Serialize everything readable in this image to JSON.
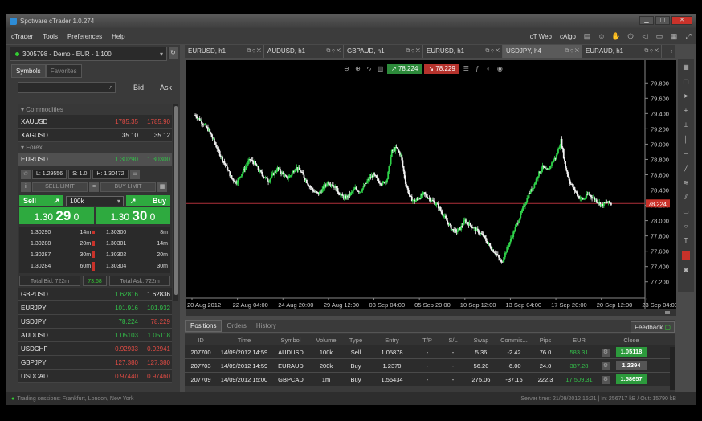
{
  "window": {
    "title": "Spotware cTrader 1.0.274"
  },
  "menu": {
    "items": [
      "cTrader",
      "Tools",
      "Preferences",
      "Help"
    ],
    "ctweb": "cT Web",
    "calgo": "cAlgo"
  },
  "account": {
    "label": "3005798 - Demo - EUR - 1:100"
  },
  "left_tabs": [
    "Symbols",
    "Favorites"
  ],
  "market_header": {
    "bid": "Bid",
    "ask": "Ask"
  },
  "groups": {
    "commodities": "Commodities",
    "forex": "Forex"
  },
  "commodities": [
    {
      "name": "XAUUSD",
      "bid": "1785.35",
      "ask": "1785.90"
    },
    {
      "name": "XAGUSD",
      "bid": "35.10",
      "ask": "35.12"
    }
  ],
  "eurusd": {
    "name": "EURUSD",
    "bid": "1.30290",
    "ask": "1.30300",
    "low": "L: 1.29556",
    "spread": "S: 1.0",
    "high": "H: 1.30472",
    "sell_limit": "SELL LIMIT",
    "buy_limit": "BUY LIMIT",
    "sell": "Sell",
    "buy": "Buy",
    "volume": "100k",
    "sell_big_a": "1.30",
    "sell_big_b": "29",
    "sell_big_c": "0",
    "buy_big_a": "1.30",
    "buy_big_b": "30",
    "buy_big_c": "0",
    "depth_bid": [
      {
        "p": "1.30290",
        "v": "14m"
      },
      {
        "p": "1.30288",
        "v": "20m"
      },
      {
        "p": "1.30287",
        "v": "30m"
      },
      {
        "p": "1.30284",
        "v": "60m"
      }
    ],
    "depth_ask": [
      {
        "p": "1.30300",
        "v": "8m"
      },
      {
        "p": "1.30301",
        "v": "14m"
      },
      {
        "p": "1.30302",
        "v": "20m"
      },
      {
        "p": "1.30304",
        "v": "30m"
      }
    ],
    "total_bid": "Total Bid: 722m",
    "spread_total": "73.68",
    "total_ask": "Total Ask: 722m"
  },
  "forex": [
    {
      "name": "GBPUSD",
      "bid": "1.62816",
      "ask": "1.62836",
      "bc": "grn",
      "ac": "wht"
    },
    {
      "name": "EURJPY",
      "bid": "101.916",
      "ask": "101.932",
      "bc": "grn",
      "ac": "grn"
    },
    {
      "name": "USDJPY",
      "bid": "78.224",
      "ask": "78.229",
      "bc": "grn",
      "ac": "red"
    },
    {
      "name": "AUDUSD",
      "bid": "1.05103",
      "ask": "1.05118",
      "bc": "grn",
      "ac": "grn"
    },
    {
      "name": "USDCHF",
      "bid": "0.92933",
      "ask": "0.92941",
      "bc": "red",
      "ac": "red"
    },
    {
      "name": "GBPJPY",
      "bid": "127.380",
      "ask": "127.380",
      "bc": "red",
      "ac": "red"
    },
    {
      "name": "USDCAD",
      "bid": "0.97440",
      "ask": "0.97460",
      "bc": "red",
      "ac": "red"
    }
  ],
  "chart_tabs": [
    "EURUSD, h1",
    "AUDUSD, h1",
    "GBPAUD, h1",
    "EURUSD, h1",
    "USDJPY, h4",
    "EURAUD, h1"
  ],
  "chart_tools": {
    "bid": "78.224",
    "ask": "78.229"
  },
  "chart_data": {
    "type": "candlestick",
    "symbol": "USDJPY, h4",
    "yticks": [
      "79.800",
      "79.600",
      "79.400",
      "79.200",
      "79.000",
      "78.800",
      "78.600",
      "78.400",
      "78.200",
      "78.000",
      "77.800",
      "77.600",
      "77.400",
      "77.200"
    ],
    "xticks": [
      "20 Aug 2012",
      "22 Aug 04:00",
      "24 Aug 20:00",
      "29 Aug 12:00",
      "03 Sep 04:00",
      "05 Sep 20:00",
      "10 Sep 12:00",
      "13 Sep 04:00",
      "17 Sep 20:00",
      "20 Sep 12:00",
      "23 Sep 04:00"
    ],
    "ylim": [
      77.05,
      79.95
    ],
    "current_price": "78.224",
    "path": [
      79.38,
      79.32,
      79.25,
      79.18,
      79.05,
      78.92,
      78.8,
      78.68,
      78.55,
      78.5,
      78.6,
      78.7,
      78.8,
      78.75,
      78.65,
      78.58,
      78.52,
      78.6,
      78.68,
      78.62,
      78.55,
      78.6,
      78.7,
      78.65,
      78.55,
      78.45,
      78.38,
      78.35,
      78.42,
      78.5,
      78.48,
      78.4,
      78.32,
      78.3,
      78.35,
      78.42,
      78.38,
      78.45,
      78.55,
      78.6,
      78.52,
      78.48,
      78.55,
      78.9,
      78.95,
      78.85,
      78.5,
      78.3,
      78.25,
      78.3,
      78.35,
      78.3,
      78.25,
      78.2,
      78.1,
      78.0,
      77.9,
      77.85,
      77.9,
      78.0,
      77.95,
      77.9,
      77.85,
      77.8,
      77.7,
      77.62,
      77.55,
      77.45,
      77.6,
      77.75,
      77.9,
      78.05,
      78.2,
      78.35,
      78.45,
      78.6,
      78.7,
      78.65,
      78.75,
      78.85,
      79.05,
      78.7,
      78.5,
      78.4,
      78.3,
      78.28,
      78.35,
      78.3,
      78.25,
      78.2,
      78.24,
      78.22
    ]
  },
  "bottom_tabs": [
    "Positions",
    "Orders",
    "History"
  ],
  "feedback": "Feedback",
  "positions": {
    "headers": [
      "ID",
      "Time",
      "Symbol",
      "Volume",
      "Type",
      "Entry",
      "T/P",
      "S/L",
      "Swap",
      "Commis...",
      "Pips",
      "EUR",
      "",
      "Close"
    ],
    "rows": [
      {
        "id": "207700",
        "time": "14/09/2012 14:59",
        "symbol": "AUDUSD",
        "volume": "100k",
        "type": "Sell",
        "entry": "1.05878",
        "tp": "-",
        "sl": "-",
        "swap": "5.36",
        "comm": "-2.42",
        "pips": "76.0",
        "eur": "583.31",
        "close": "1.05118",
        "cc": "grn"
      },
      {
        "id": "207703",
        "time": "14/09/2012 14:59",
        "symbol": "EURAUD",
        "volume": "200k",
        "type": "Buy",
        "entry": "1.2370",
        "tp": "-",
        "sl": "-",
        "swap": "56.20",
        "comm": "-6.00",
        "pips": "24.0",
        "eur": "387.28",
        "close": "1.2394",
        "cc": "neu"
      },
      {
        "id": "207709",
        "time": "14/09/2012 15:00",
        "symbol": "GBPCAD",
        "volume": "1m",
        "type": "Buy",
        "entry": "1.56434",
        "tp": "-",
        "sl": "-",
        "swap": "275.06",
        "comm": "-37.15",
        "pips": "222.3",
        "eur": "17 509.31",
        "close": "1.58657",
        "cc": "grn"
      }
    ]
  },
  "status": {
    "sessions": "Trading sessions:  Frankfurt, London, New York",
    "server": "Server time: 21/09/2012 16:21  |  In: 256717 kB / Out: 15790 kB"
  }
}
